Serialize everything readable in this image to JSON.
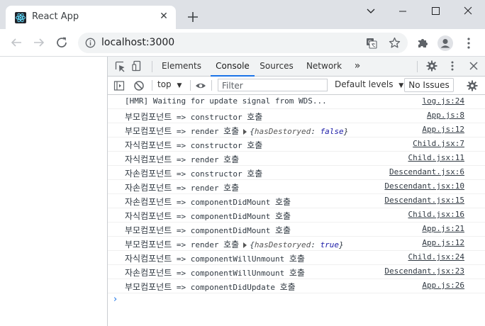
{
  "browser": {
    "tab_title": "React App",
    "url": "localhost:3000"
  },
  "devtools": {
    "tabs": [
      {
        "label": "Elements"
      },
      {
        "label": "Console",
        "active": true
      },
      {
        "label": "Sources"
      },
      {
        "label": "Network"
      }
    ],
    "more_tabs": "»",
    "context": "top",
    "filter_placeholder": "Filter",
    "levels_label": "Default levels",
    "issues_label": "No Issues"
  },
  "console": {
    "rows": [
      {
        "message": "[HMR] Waiting for update signal from WDS...",
        "source": "log.js:24"
      },
      {
        "ko": "부모컴포넌트",
        "message": " => constructor ",
        "ko2": "호출",
        "source": "App.js:8"
      },
      {
        "ko": "부모컴포넌트",
        "message": " => render ",
        "ko2": "호출",
        "object": {
          "key": "hasDestoryed",
          "value": "false"
        },
        "source": "App.js:12"
      },
      {
        "ko": "자식컴포넌트",
        "message": " => constructor ",
        "ko2": "호출",
        "source": "Child.jsx:7"
      },
      {
        "ko": "자식컴포넌트",
        "message": " => render ",
        "ko2": "호출",
        "source": "Child.jsx:11"
      },
      {
        "ko": "자손컴포넌트",
        "message": " => constructor ",
        "ko2": "호출",
        "source": "Descendant.jsx:6"
      },
      {
        "ko": "자손컴포넌트",
        "message": " => render ",
        "ko2": "호출",
        "source": "Descendant.jsx:10"
      },
      {
        "ko": "자손컴포넌트",
        "message": " => componentDidMount ",
        "ko2": "호출",
        "source": "Descendant.jsx:15"
      },
      {
        "ko": "자식컴포넌트",
        "message": " => componentDidMount ",
        "ko2": "호출",
        "source": "Child.jsx:16"
      },
      {
        "ko": "부모컴포넌트",
        "message": " => componentDidMount ",
        "ko2": "호출",
        "source": "App.js:21"
      },
      {
        "ko": "부모컴포넌트",
        "message": " => render ",
        "ko2": "호출",
        "object": {
          "key": "hasDestoryed",
          "value": "true"
        },
        "source": "App.js:12"
      },
      {
        "ko": "자식컴포넌트",
        "message": " => componentWillUnmount ",
        "ko2": "호출",
        "source": "Child.jsx:24"
      },
      {
        "ko": "자손컴포넌트",
        "message": " => componentWillUnmount ",
        "ko2": "호출",
        "source": "Descendant.jsx:23"
      },
      {
        "ko": "부모컴포넌트",
        "message": " => componentDidUpdate ",
        "ko2": "호출",
        "source": "App.js:26"
      }
    ],
    "prompt": "›"
  }
}
